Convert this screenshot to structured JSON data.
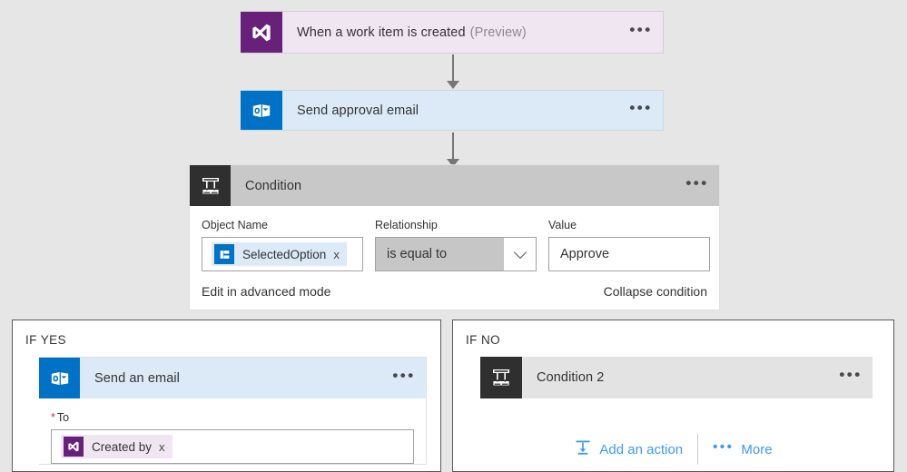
{
  "flow": {
    "trigger": {
      "title": "When a work item is created",
      "subtitle": "(Preview)",
      "icon": "visual-studio-icon",
      "menu": "•••",
      "icon_color": "#68217a",
      "background": "#f0e6f2"
    },
    "approval_action": {
      "title": "Send approval email",
      "icon": "outlook-icon",
      "menu": "•••",
      "icon_color": "#0072c6",
      "background": "#dceaf7"
    },
    "condition": {
      "title": "Condition",
      "icon": "condition-branch-icon",
      "menu": "•••",
      "fields": {
        "object_name": {
          "label": "Object Name",
          "token_label": "SelectedOption",
          "token_icon": "approval-option-icon",
          "token_remove": "x"
        },
        "relationship": {
          "label": "Relationship",
          "selected": "is equal to",
          "caret": "chevron-down-icon"
        },
        "value": {
          "label": "Value",
          "text": "Approve"
        }
      },
      "footer": {
        "advanced_mode": "Edit in advanced mode",
        "collapse": "Collapse condition"
      }
    },
    "branch_yes": {
      "label": "IF YES",
      "action": {
        "title": "Send an email",
        "icon": "outlook-icon",
        "menu": "•••",
        "to_label": "To",
        "to_required": "*",
        "to_token_label": "Created by",
        "to_token_icon": "visual-studio-icon",
        "to_token_remove": "x"
      }
    },
    "branch_no": {
      "label": "IF NO",
      "action": {
        "title": "Condition 2",
        "icon": "condition-branch-icon",
        "menu": "•••"
      },
      "links": {
        "add_action": "Add an action",
        "add_action_icon": "insert-action-icon",
        "more": "More",
        "more_icon": "ellipsis-icon"
      }
    }
  }
}
